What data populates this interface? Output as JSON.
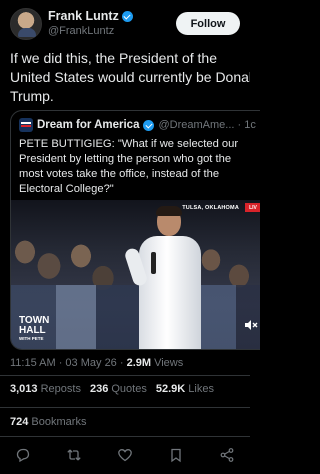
{
  "author": {
    "name": "Frank Luntz",
    "handle": "@FrankLuntz",
    "verified": true,
    "follow_label": "Follow"
  },
  "tweet": {
    "lines": [
      "If we did this, the President of the",
      "United States would currently be Donal",
      "Trump."
    ]
  },
  "quote": {
    "name": "Dream for America",
    "handle": "@DreamAme... · 1c",
    "lines": [
      "PETE BUTTIGIEG: \"What if we selected our",
      "President by letting the person who got the",
      "most votes take the office, instead of the",
      "Electoral College?\""
    ],
    "video": {
      "location_label": "TULSA, OKLAHOMA",
      "live_label": "LIV",
      "logo_line1": "TOWN",
      "logo_line2": "HALL",
      "logo_sub": "WITH PETE"
    }
  },
  "meta": {
    "time_date": "11:15 AM · 03 May 26 · ",
    "views_count": "2.9M",
    "views_label": " Views"
  },
  "stats": {
    "reposts_count": "3,013",
    "reposts_label": "Reposts",
    "quotes_count": "236",
    "quotes_label": "Quotes",
    "likes_count": "52.9K",
    "likes_label": "Likes",
    "bookmarks_count": "724",
    "bookmarks_label": "Bookmarks"
  },
  "icons": {
    "accent": "#1d9bf0",
    "muted": "#71767b",
    "actions": [
      "reply-icon",
      "repost-icon",
      "like-icon",
      "bookmark-icon",
      "share-icon"
    ]
  }
}
